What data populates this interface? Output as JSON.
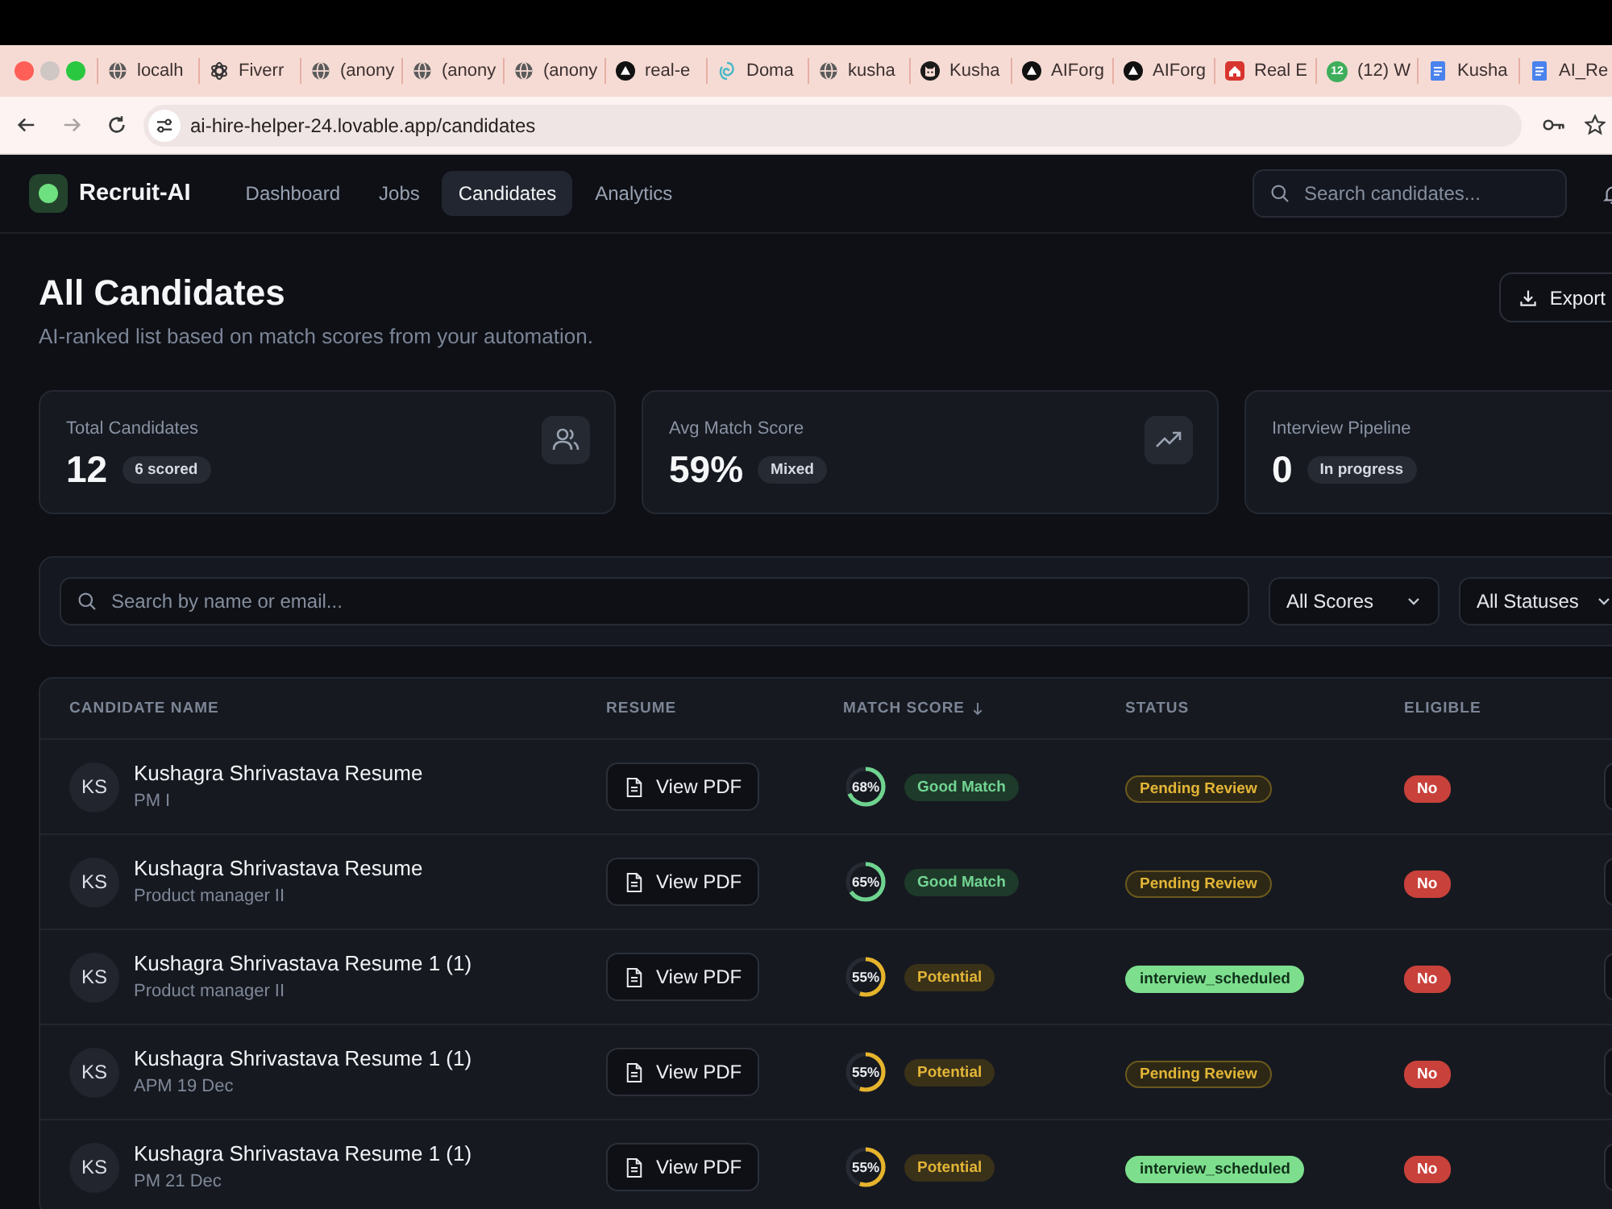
{
  "browser": {
    "tabs": [
      {
        "label": "localh",
        "kind": "globe"
      },
      {
        "label": "Fiverr",
        "kind": "atom"
      },
      {
        "label": "(anony",
        "kind": "globe"
      },
      {
        "label": "(anony",
        "kind": "globe"
      },
      {
        "label": "(anony",
        "kind": "globe"
      },
      {
        "label": "real-e",
        "kind": "triangle"
      },
      {
        "label": "Doma",
        "kind": "swirl"
      },
      {
        "label": "kusha",
        "kind": "globe"
      },
      {
        "label": "Kusha",
        "kind": "cat"
      },
      {
        "label": "AIForg",
        "kind": "triangle"
      },
      {
        "label": "AIForg",
        "kind": "triangle"
      },
      {
        "label": "Real E",
        "kind": "house"
      },
      {
        "label": "(12) W",
        "kind": "counter",
        "badge": "12"
      },
      {
        "label": "Kusha",
        "kind": "document"
      },
      {
        "label": "AI_Re",
        "kind": "document"
      }
    ],
    "url": "ai-hire-helper-24.lovable.app/candidates"
  },
  "header": {
    "brand": "Recruit-AI",
    "nav": [
      {
        "label": "Dashboard",
        "selected": false
      },
      {
        "label": "Jobs",
        "selected": false
      },
      {
        "label": "Candidates",
        "selected": true
      },
      {
        "label": "Analytics",
        "selected": false
      }
    ],
    "search": {
      "placeholder": "Search candidates..."
    }
  },
  "page": {
    "title": "All Candidates",
    "subtitle": "AI-ranked list based on match scores from your automation.",
    "export_button": "Export"
  },
  "stats": [
    {
      "label": "Total Candidates",
      "value": "12",
      "badge": "6 scored",
      "kind": "users"
    },
    {
      "label": "Avg Match Score",
      "value": "59%",
      "badge": "Mixed",
      "kind": "trend"
    },
    {
      "label": "Interview Pipeline",
      "value": "0",
      "badge": "In progress"
    }
  ],
  "filters": {
    "search": {
      "placeholder": "Search by name or email..."
    },
    "selects": [
      {
        "label": "All Scores"
      },
      {
        "label": "All Statuses"
      }
    ]
  },
  "table": {
    "columns": [
      {
        "label": "CANDIDATE NAME",
        "sorted": false
      },
      {
        "label": "RESUME",
        "sorted": false
      },
      {
        "label": "MATCH SCORE",
        "sorted": true
      },
      {
        "label": "STATUS",
        "sorted": false
      },
      {
        "label": "ELIGIBLE",
        "sorted": false
      }
    ],
    "rows": [
      {
        "initials": "KS",
        "name": "Kushagra Shrivastava Resume",
        "role": "PM I",
        "resume_button": "View PDF",
        "score": "68%",
        "level": 0.68,
        "match": {
          "label": "Good Match",
          "kind": "good"
        },
        "status": {
          "label": "Pending Review",
          "kind": "pending"
        },
        "eligible": false,
        "eligible_label": "No"
      },
      {
        "initials": "KS",
        "name": "Kushagra Shrivastava Resume",
        "role": "Product manager II",
        "resume_button": "View PDF",
        "score": "65%",
        "level": 0.65,
        "match": {
          "label": "Good Match",
          "kind": "good"
        },
        "status": {
          "label": "Pending Review",
          "kind": "pending"
        },
        "eligible": false,
        "eligible_label": "No"
      },
      {
        "initials": "KS",
        "name": "Kushagra Shrivastava Resume 1 (1)",
        "role": "Product manager II",
        "resume_button": "View PDF",
        "score": "55%",
        "level": 0.55,
        "match": {
          "label": "Potential",
          "kind": "potential"
        },
        "status": {
          "label": "interview_scheduled",
          "kind": "scheduled"
        },
        "eligible": false,
        "eligible_label": "No"
      },
      {
        "initials": "KS",
        "name": "Kushagra Shrivastava Resume 1 (1)",
        "role": "APM 19 Dec",
        "resume_button": "View PDF",
        "score": "55%",
        "level": 0.55,
        "match": {
          "label": "Potential",
          "kind": "potential"
        },
        "status": {
          "label": "Pending Review",
          "kind": "pending"
        },
        "eligible": false,
        "eligible_label": "No"
      },
      {
        "initials": "KS",
        "name": "Kushagra Shrivastava Resume 1 (1)",
        "role": "PM 21 Dec",
        "resume_button": "View PDF",
        "score": "55%",
        "level": 0.55,
        "match": {
          "label": "Potential",
          "kind": "potential"
        },
        "status": {
          "label": "interview_scheduled",
          "kind": "scheduled"
        },
        "eligible": false,
        "eligible_label": "No"
      }
    ]
  }
}
